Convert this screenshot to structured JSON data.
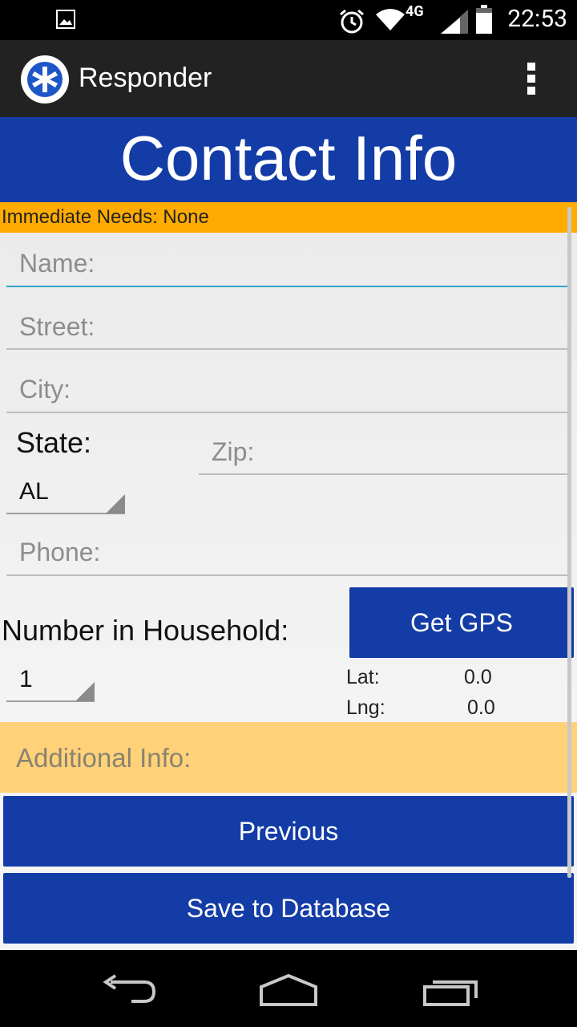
{
  "status_bar": {
    "time": "22:53",
    "network": "4G"
  },
  "action_bar": {
    "title": "Responder"
  },
  "header": {
    "title": "Contact Info"
  },
  "needs_banner": {
    "text": "Immediate Needs: None"
  },
  "form": {
    "name_placeholder": "Name:",
    "street_placeholder": "Street:",
    "city_placeholder": "City:",
    "state_label": "State:",
    "state_value": "AL",
    "zip_placeholder": "Zip:",
    "phone_placeholder": "Phone:",
    "household_label": "Number in Household:",
    "household_value": "1",
    "get_gps_label": "Get GPS",
    "lat_label": "Lat:",
    "lat_value": "0.0",
    "lng_label": "Lng:",
    "lng_value": "0.0",
    "additional_placeholder": "Additional Info:"
  },
  "buttons": {
    "previous": "Previous",
    "save": "Save to Database"
  },
  "colors": {
    "primary_blue": "#143ca7",
    "banner_orange": "#ffab00",
    "additional_info_bg": "#ffd27a",
    "focus_line": "#33a3c9"
  }
}
